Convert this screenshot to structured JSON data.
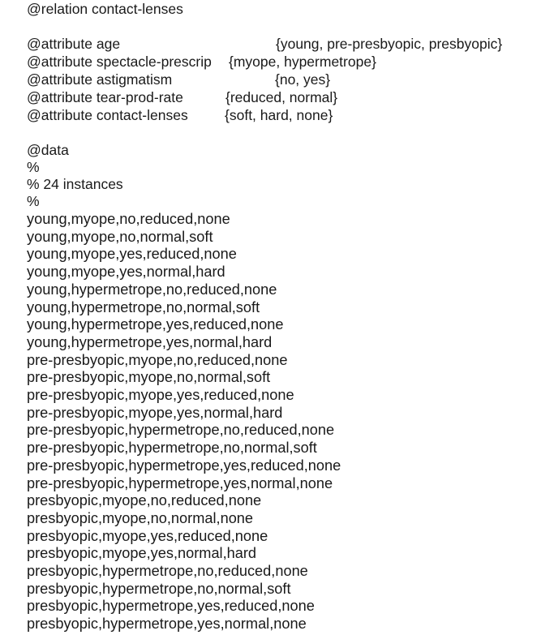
{
  "document": {
    "relation": "@relation contact-lenses",
    "attributes": [
      {
        "decl": "@attribute age",
        "values": "{young, pre-presbyopic, presbyopic}"
      },
      {
        "decl": "@attribute spectacle-prescrip",
        "values": "{myope, hypermetrope}"
      },
      {
        "decl": "@attribute astigmatism",
        "values": "{no, yes}"
      },
      {
        "decl": "@attribute tear-prod-rate",
        "values": "{reduced, normal}"
      },
      {
        "decl": "@attribute contact-lenses",
        "values": "{soft, hard, none}"
      }
    ],
    "data_header": "@data",
    "comments": [
      "%",
      "% 24 instances",
      "%"
    ],
    "rows": [
      "young,myope,no,reduced,none",
      "young,myope,no,normal,soft",
      "young,myope,yes,reduced,none",
      "young,myope,yes,normal,hard",
      "young,hypermetrope,no,reduced,none",
      "young,hypermetrope,no,normal,soft",
      "young,hypermetrope,yes,reduced,none",
      "young,hypermetrope,yes,normal,hard",
      "pre-presbyopic,myope,no,reduced,none",
      "pre-presbyopic,myope,no,normal,soft",
      "pre-presbyopic,myope,yes,reduced,none",
      "pre-presbyopic,myope,yes,normal,hard",
      "pre-presbyopic,hypermetrope,no,reduced,none",
      "pre-presbyopic,hypermetrope,no,normal,soft",
      "pre-presbyopic,hypermetrope,yes,reduced,none",
      "pre-presbyopic,hypermetrope,yes,normal,none",
      "presbyopic,myope,no,reduced,none",
      "presbyopic,myope,no,normal,none",
      "presbyopic,myope,yes,reduced,none",
      "presbyopic,myope,yes,normal,hard",
      "presbyopic,hypermetrope,no,reduced,none",
      "presbyopic,hypermetrope,no,normal,soft",
      "presbyopic,hypermetrope,yes,reduced,none",
      "presbyopic,hypermetrope,yes,normal,none"
    ]
  }
}
